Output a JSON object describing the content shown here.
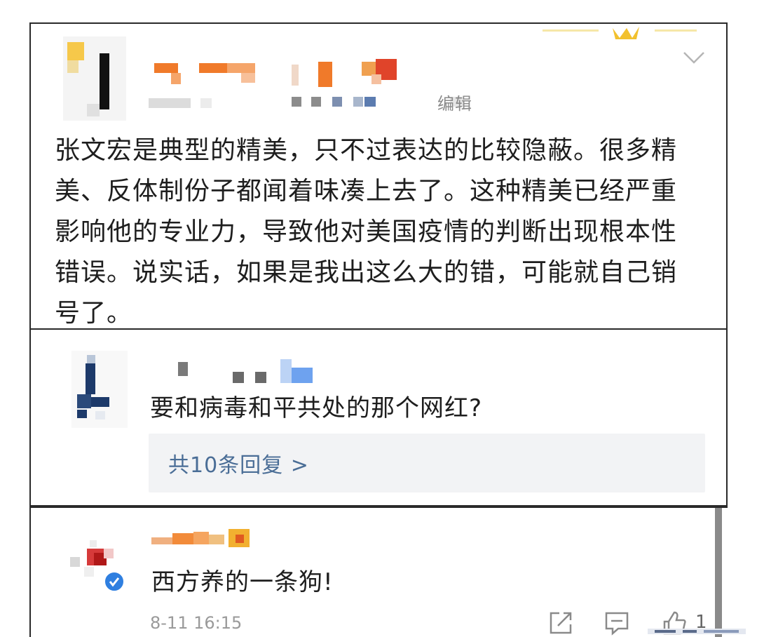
{
  "post": {
    "edit_label": "编辑",
    "text": "张文宏是典型的精美，只不过表达的比较隐蔽。很多精美、反体制份子都闻着味凑上去了。这种精美已经严重影响他的专业力，导致他对美国疫情的判断出现根本性错误。说实话，如果是我出这么大的错，可能就自己销号了。",
    "more_icon": "chevron-down-icon"
  },
  "comment_1": {
    "text": "要和病毒和平共处的那个网红?",
    "replies_link": "共10条回复 >"
  },
  "comment_2": {
    "text": "西方养的一条狗!",
    "time": "8-11 16:15",
    "like_count": "1",
    "icons": [
      "share-icon",
      "comment-icon",
      "like-icon"
    ],
    "verified_color": "#2f7fe0"
  },
  "colors": {
    "link": "#4a6d96",
    "reply_bg": "#f2f3f5",
    "border": "#2a2a2a"
  }
}
